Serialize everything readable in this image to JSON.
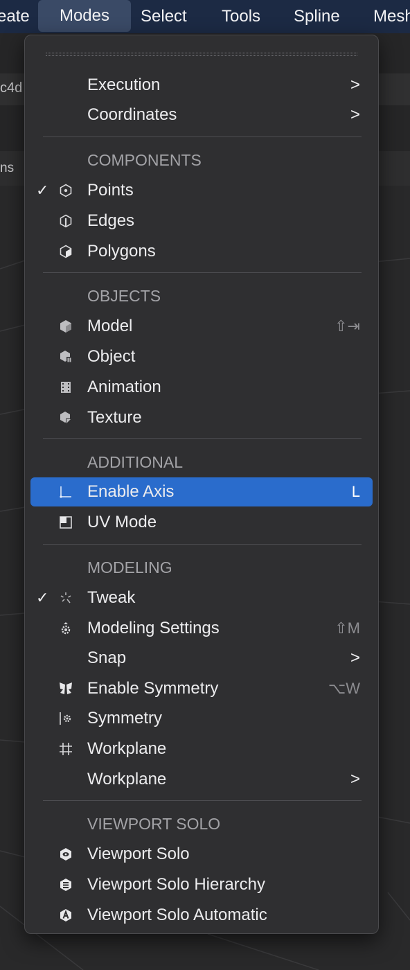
{
  "menubar": {
    "items": [
      "eate",
      "Modes",
      "Select",
      "Tools",
      "Spline",
      "Mesh"
    ]
  },
  "background": {
    "tab_text": "c4d",
    "toolbar_text": "ns"
  },
  "menu": {
    "title": "Modes",
    "execution": {
      "label": "Execution",
      "arrow": ">"
    },
    "coordinates": {
      "label": "Coordinates",
      "arrow": ">"
    },
    "components": {
      "header": "COMPONENTS",
      "points": {
        "label": "Points",
        "check": "✓"
      },
      "edges": {
        "label": "Edges"
      },
      "polygons": {
        "label": "Polygons"
      }
    },
    "objects": {
      "header": "OBJECTS",
      "model": {
        "label": "Model",
        "shortcut": "⇧⇥"
      },
      "object": {
        "label": "Object"
      },
      "animation": {
        "label": "Animation"
      },
      "texture": {
        "label": "Texture"
      }
    },
    "additional": {
      "header": "ADDITIONAL",
      "enable_axis": {
        "label": "Enable Axis",
        "shortcut": "L"
      },
      "uv_mode": {
        "label": "UV Mode"
      }
    },
    "modeling": {
      "header": "MODELING",
      "tweak": {
        "label": "Tweak",
        "check": "✓"
      },
      "modeling_settings": {
        "label": "Modeling Settings",
        "shortcut": "⇧M"
      },
      "snap": {
        "label": "Snap",
        "arrow": ">"
      },
      "enable_symmetry": {
        "label": "Enable Symmetry",
        "shortcut": "⌥W"
      },
      "symmetry": {
        "label": "Symmetry"
      },
      "workplane_toggle": {
        "label": "Workplane"
      },
      "workplane_sub": {
        "label": "Workplane",
        "arrow": ">"
      }
    },
    "viewport_solo": {
      "header": "VIEWPORT SOLO",
      "solo": {
        "label": "Viewport Solo"
      },
      "solo_hierarchy": {
        "label": "Viewport Solo Hierarchy"
      },
      "solo_automatic": {
        "label": "Viewport Solo Automatic"
      }
    }
  },
  "colors": {
    "highlight": "#2a6ccc",
    "menu_bg": "#2f2f31",
    "menubar_bg": "#1c2a44"
  }
}
